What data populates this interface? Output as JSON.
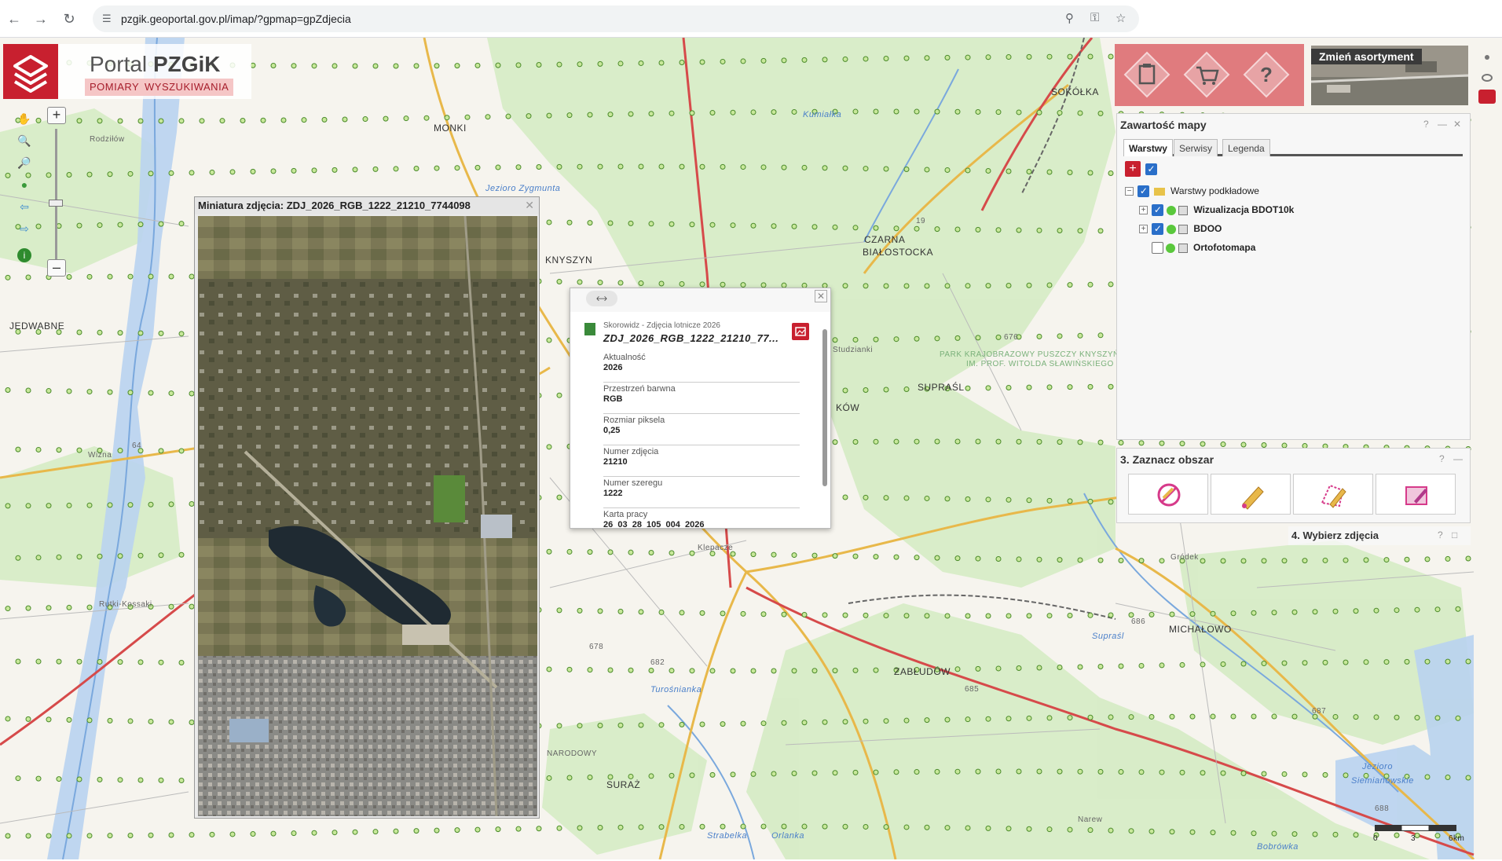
{
  "browser": {
    "url": "pzgik.geoportal.gov.pl/imap/?gpmap=gpZdjecia"
  },
  "logo": {
    "title_light": "Portal ",
    "title_bold": "PZGiK",
    "tab_pomiary": "POMIARY",
    "tab_wyszukiwania": "WYSZUKIWANIA"
  },
  "map_labels": {
    "monki": "MONKI",
    "knyszyn": "KNYSZYN",
    "jedwabne": "JEDWABNE",
    "czarna": "CZARNA",
    "bialostocka": "BIAŁOSTOCKA",
    "supraśl": "SUPRAŚL",
    "sokolka": "SOKÓŁKA",
    "michalowo": "MICHAŁOWO",
    "zabludow": "ZABŁUDÓW",
    "suraz": "SURAŻ",
    "narew": "Narew",
    "grodek": "Gródek",
    "kleosin": "Klepacze",
    "rutki": "Rutki-Kossaki",
    "wizna": "Wizna",
    "rodzilow": "Rodziłów",
    "studzianki": "Studzianki",
    "kow": "KÓW",
    "park": "PARK KRAJOBRAZOWY PUSZCZY KNYSZYŃSKIEJ",
    "park2": "IM. PROF. WITOLDA SŁAWIŃSKIEGO",
    "rzeka_supr": "Supraśl",
    "rzeka_narew": "Narew",
    "jezioro_z": "Jezioro Zygmunta",
    "jezioro_s": "Jezioro",
    "jezioro_s2": "Siemianówskie",
    "kumialka": "Kumiałka",
    "turosnianka": "Turośnianka",
    "orlanka": "Orlanka",
    "strabelka": "Strabelka",
    "bobrowka": "Bobrówka",
    "narodowy": "NARODOWY",
    "road_64": "64",
    "road_676": "676",
    "road_678": "678",
    "road_682": "682",
    "road_685": "685",
    "road_686": "686",
    "road_687": "687",
    "road_688": "688",
    "road_19": "19",
    "scale_0": "0",
    "scale_3": "3",
    "scale_6": "6km"
  },
  "thumbnail": {
    "title": "Miniatura zdjęcia: ZDJ_2026_RGB_1222_21210_7744098"
  },
  "popup": {
    "source": "Skorowidz - Zdjęcia lotnicze 2026",
    "name": "ZDJ_2026_RGB_1222_21210_77...",
    "attrs": [
      {
        "k": "Aktualność",
        "v": "2026"
      },
      {
        "k": "Przestrzeń barwna",
        "v": "RGB"
      },
      {
        "k": "Rozmiar piksela",
        "v": "0,25"
      },
      {
        "k": "Numer zdjęcia",
        "v": "21210"
      },
      {
        "k": "Numer szeregu",
        "v": "1222"
      },
      {
        "k": "Karta pracy",
        "v": "26_03_28_105_004_2026"
      }
    ]
  },
  "asortyment": {
    "label": "Zmień asortyment"
  },
  "layers": {
    "title": "Zawartość mapy",
    "tabs": [
      "Warstwy",
      "Serwisy",
      "Legenda"
    ],
    "group": "Warstwy podkładowe",
    "items": [
      "Wizualizacja BDOT10k",
      "BDOO",
      "Ortofotomapa"
    ]
  },
  "zaznacz": {
    "title": "3. Zaznacz obszar"
  },
  "wybierz": {
    "title": "4. Wybierz zdjęcia"
  },
  "colors": {
    "brand": "#c8202f",
    "toolbar": "#e07b7e",
    "forest": "#d7ecc6",
    "water": "#aac8ec"
  }
}
